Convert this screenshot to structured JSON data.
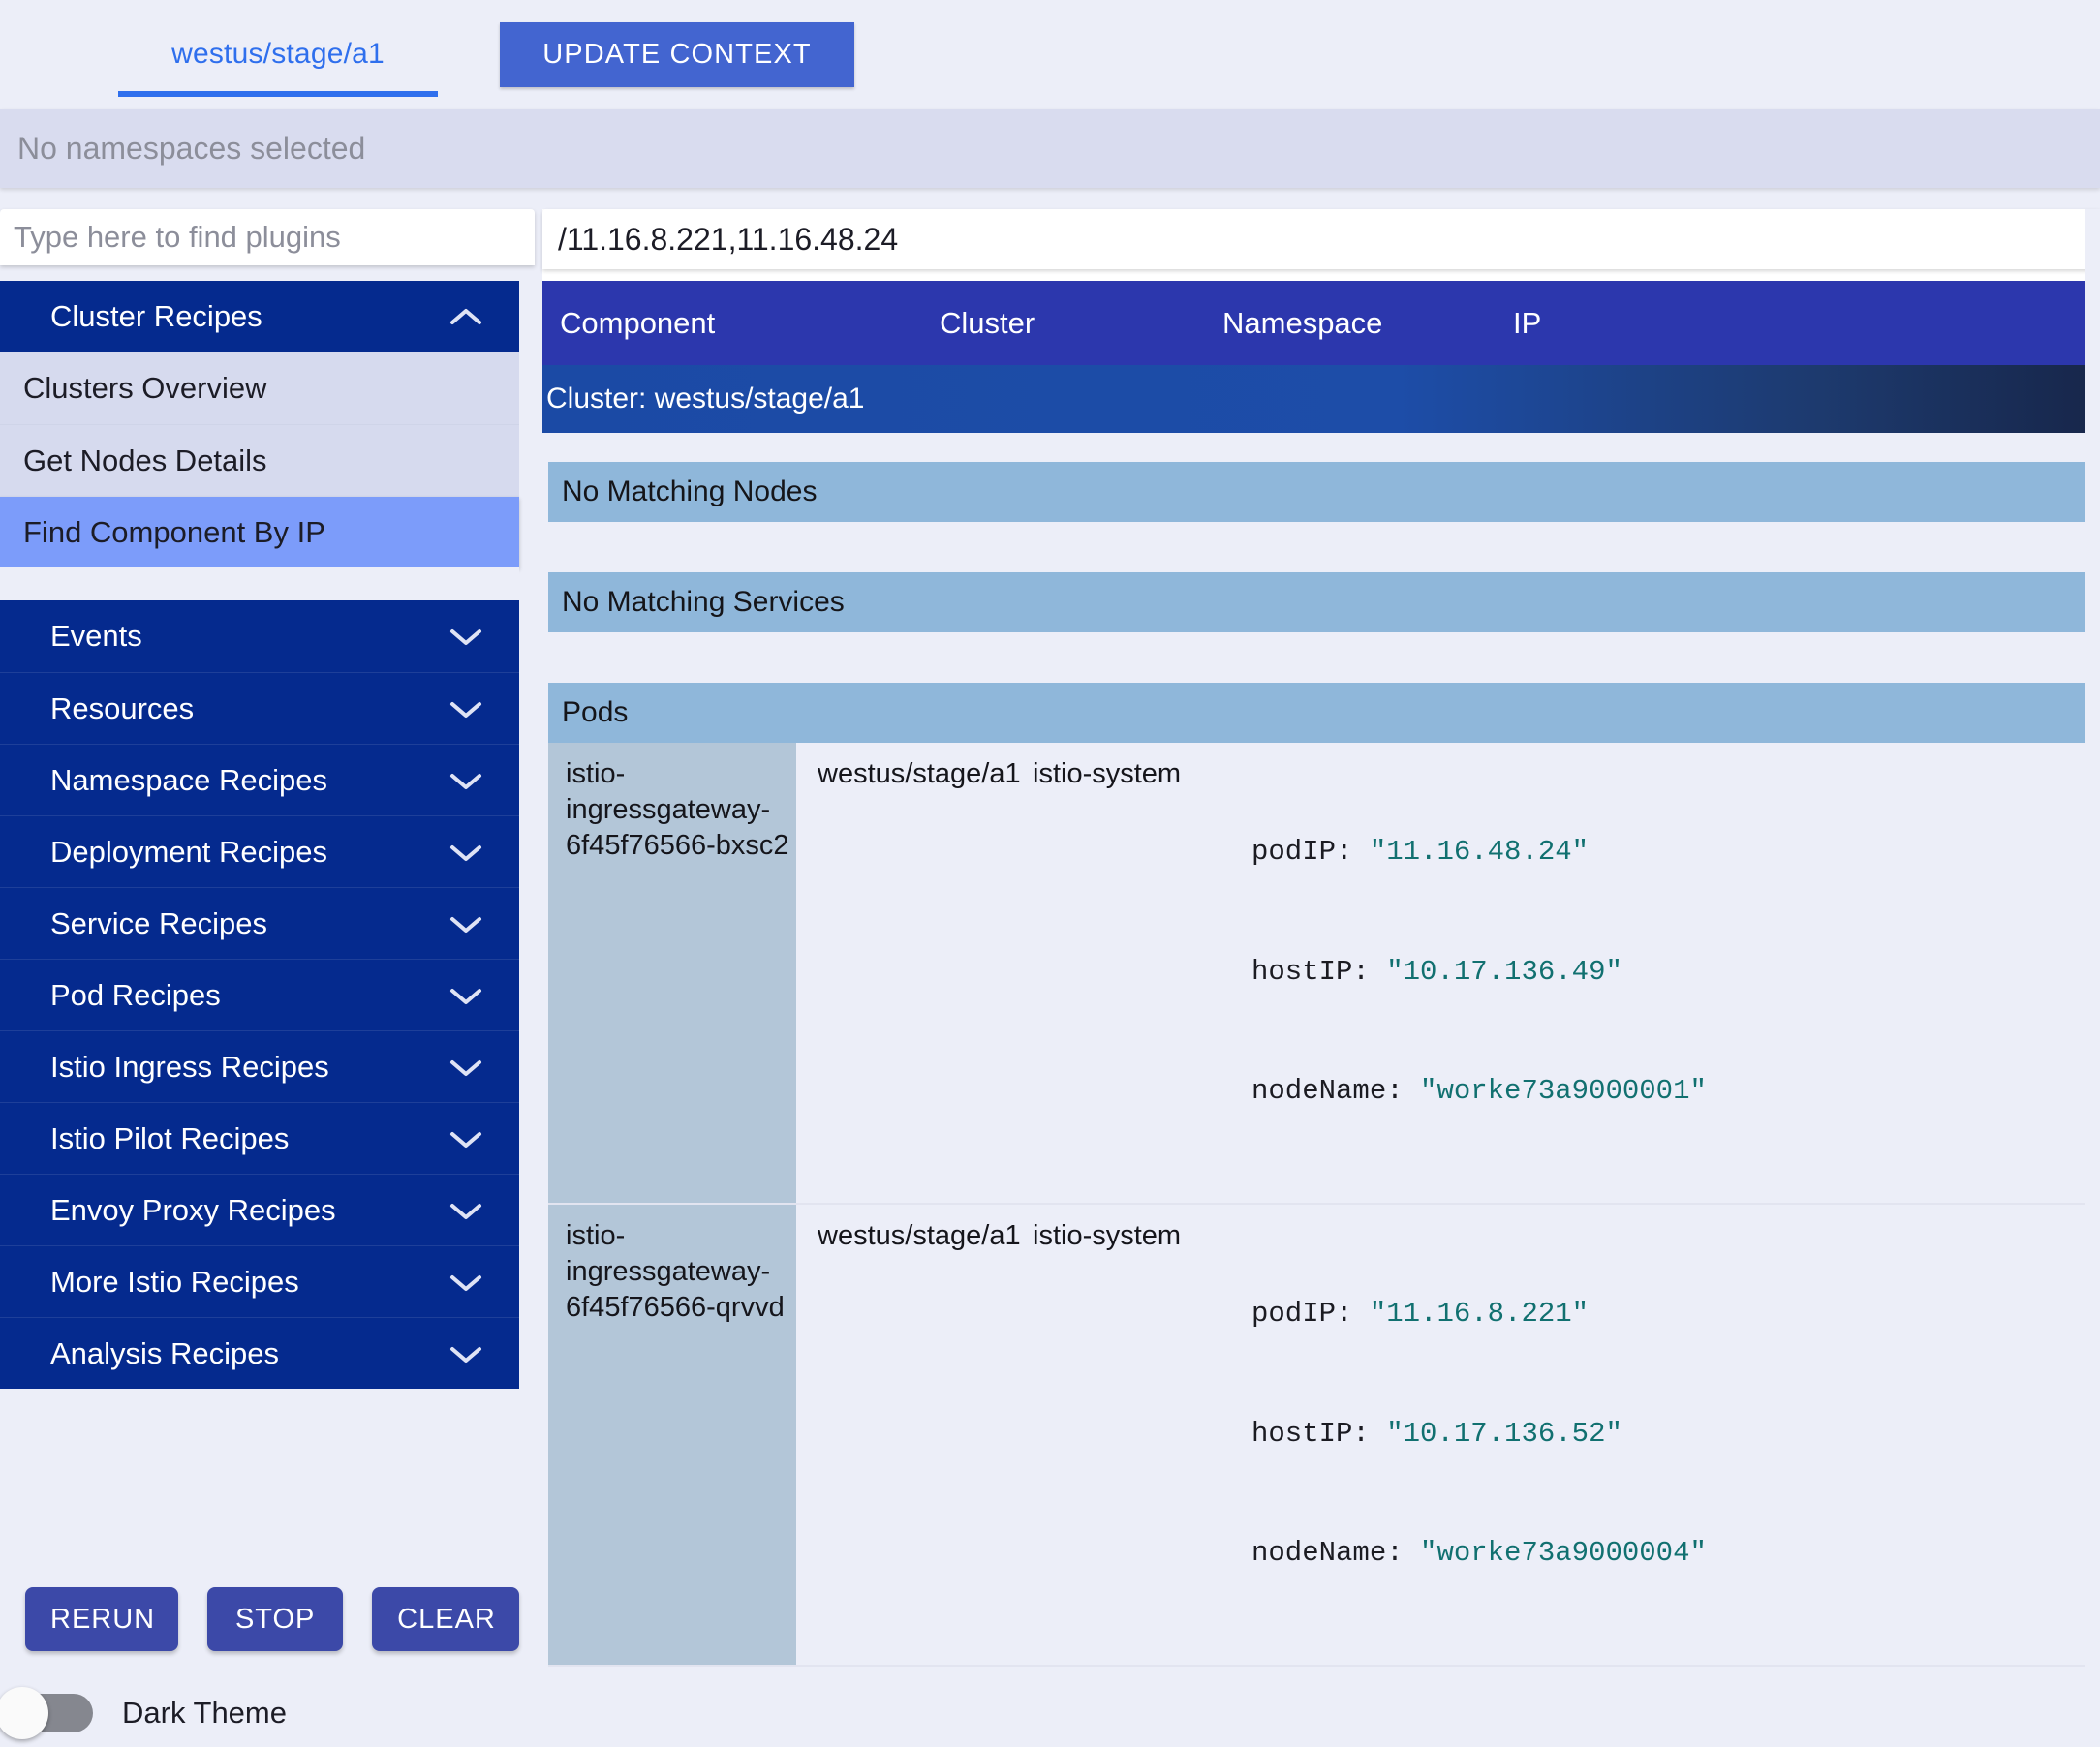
{
  "topbar": {
    "context_tab": "westus/stage/a1",
    "update_button": "UPDATE CONTEXT"
  },
  "namespace_bar": {
    "text": "No namespaces selected"
  },
  "sidebar": {
    "search_placeholder": "Type here to find plugins",
    "groups": [
      {
        "label": "Cluster Recipes",
        "expanded": true,
        "chevron": "chevron-up-icon",
        "items": [
          {
            "label": "Clusters Overview",
            "selected": false
          },
          {
            "label": "Get Nodes Details",
            "selected": false
          },
          {
            "label": "Find Component By IP",
            "selected": true
          }
        ]
      },
      {
        "label": "Events",
        "expanded": false,
        "chevron": "chevron-down-icon",
        "items": []
      },
      {
        "label": "Resources",
        "expanded": false,
        "chevron": "chevron-down-icon",
        "items": []
      },
      {
        "label": "Namespace Recipes",
        "expanded": false,
        "chevron": "chevron-down-icon",
        "items": []
      },
      {
        "label": "Deployment Recipes",
        "expanded": false,
        "chevron": "chevron-down-icon",
        "items": []
      },
      {
        "label": "Service Recipes",
        "expanded": false,
        "chevron": "chevron-down-icon",
        "items": []
      },
      {
        "label": "Pod Recipes",
        "expanded": false,
        "chevron": "chevron-down-icon",
        "items": []
      },
      {
        "label": "Istio Ingress Recipes",
        "expanded": false,
        "chevron": "chevron-down-icon",
        "items": []
      },
      {
        "label": "Istio Pilot Recipes",
        "expanded": false,
        "chevron": "chevron-down-icon",
        "items": []
      },
      {
        "label": "Envoy Proxy Recipes",
        "expanded": false,
        "chevron": "chevron-down-icon",
        "items": []
      },
      {
        "label": "More Istio Recipes",
        "expanded": false,
        "chevron": "chevron-down-icon",
        "items": []
      },
      {
        "label": "Analysis Recipes",
        "expanded": false,
        "chevron": "chevron-down-icon",
        "items": []
      }
    ],
    "actions": {
      "rerun": "RERUN",
      "stop": "STOP",
      "clear": "CLEAR"
    },
    "theme_toggle": {
      "label": "Dark Theme",
      "on": false
    }
  },
  "main": {
    "ip_query": "/11.16.8.221,11.16.48.24",
    "columns": [
      "Component",
      "Cluster",
      "Namespace",
      "IP"
    ],
    "cluster_row": "Cluster: westus/stage/a1",
    "sections": [
      {
        "label": "No Matching Nodes"
      },
      {
        "label": "No Matching Services"
      },
      {
        "label": "Pods"
      }
    ],
    "pods": [
      {
        "component": "istio-ingressgateway-6f45f76566-bxsc2",
        "cluster": "westus/stage/a1",
        "namespace": "istio-system",
        "ip_lines": [
          {
            "key": "podIP:",
            "value": "\"11.16.48.24\""
          },
          {
            "key": "hostIP:",
            "value": "\"10.17.136.49\""
          },
          {
            "key": "nodeName:",
            "value": "\"worke73a9000001\""
          }
        ]
      },
      {
        "component": "istio-ingressgateway-6f45f76566-qrvvd",
        "cluster": "westus/stage/a1",
        "namespace": "istio-system",
        "ip_lines": [
          {
            "key": "podIP:",
            "value": "\"11.16.8.221\""
          },
          {
            "key": "hostIP:",
            "value": "\"10.17.136.52\""
          },
          {
            "key": "nodeName:",
            "value": "\"worke73a9000004\""
          }
        ]
      }
    ]
  },
  "colors": {
    "accent_blue": "#2f6fed",
    "button_blue": "#4365d0",
    "nav_dark_blue": "#052a8e",
    "nav_sub_bg": "#d6daee",
    "nav_selected": "#7c9cfa",
    "table_header": "#2c37ad",
    "section_band": "#8fb7da",
    "pod_name_cell": "#b3c6d8",
    "code_value": "#117070",
    "page_bg": "#eceef8"
  }
}
